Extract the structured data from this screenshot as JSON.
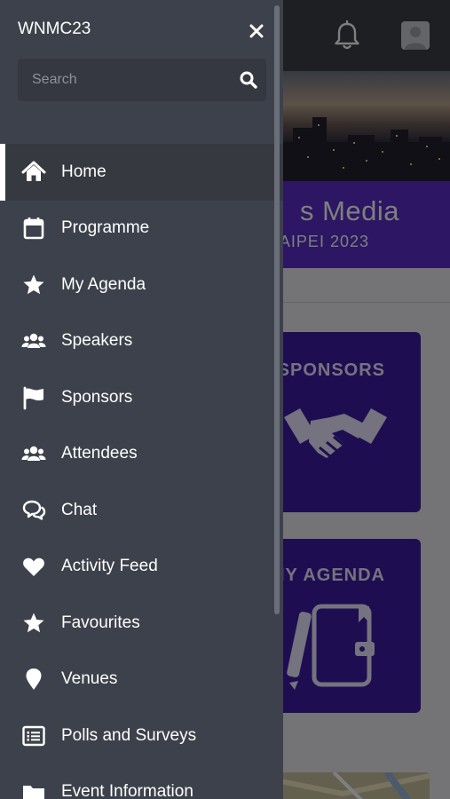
{
  "drawer": {
    "title": "WNMC23",
    "search_placeholder": "Search",
    "items": [
      {
        "label": "Home",
        "icon": "home-icon",
        "active": true
      },
      {
        "label": "Programme",
        "icon": "calendar-icon",
        "active": false
      },
      {
        "label": "My Agenda",
        "icon": "star-icon",
        "active": false
      },
      {
        "label": "Speakers",
        "icon": "users-icon",
        "active": false
      },
      {
        "label": "Sponsors",
        "icon": "flag-icon",
        "active": false
      },
      {
        "label": "Attendees",
        "icon": "users-icon",
        "active": false
      },
      {
        "label": "Chat",
        "icon": "chat-icon",
        "active": false
      },
      {
        "label": "Activity Feed",
        "icon": "heart-icon",
        "active": false
      },
      {
        "label": "Favourites",
        "icon": "star-icon",
        "active": false
      },
      {
        "label": "Venues",
        "icon": "map-pin-icon",
        "active": false
      },
      {
        "label": "Polls and Surveys",
        "icon": "list-icon",
        "active": false
      },
      {
        "label": "Event Information",
        "icon": "folder-icon",
        "active": false
      }
    ]
  },
  "background": {
    "event_name": "s Media",
    "event_subtitle": "AIPEI 2023",
    "tiles": [
      {
        "label": "SPONSORS",
        "icon": "handshake-icon"
      },
      {
        "label": "MY AGENDA",
        "icon": "notebook-icon"
      }
    ]
  },
  "colors": {
    "drawer_bg": "#3d414b",
    "accent_purple": "#5b2cc7",
    "tile_purple": "#3d1ca3"
  }
}
